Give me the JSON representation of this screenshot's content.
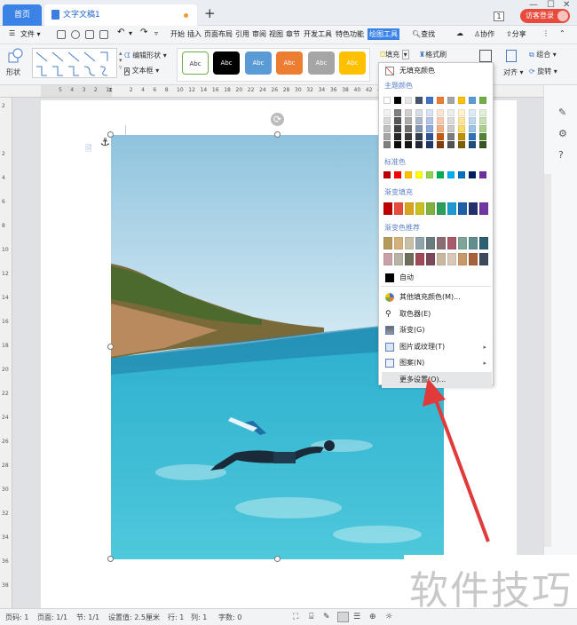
{
  "titlebar": {
    "home_tab": "首页",
    "doc_tab": "文字文稿1",
    "window_number": "1",
    "visitor_label": "访客登录"
  },
  "menubar": {
    "file": "文件",
    "items": [
      "开始",
      "插入",
      "页面布局",
      "引用",
      "审阅",
      "视图",
      "章节",
      "开发工具",
      "特色功能",
      "绘图工具"
    ],
    "search": "查找",
    "collab": "协作",
    "share": "分享"
  },
  "ribbon": {
    "shape_label": "形状",
    "edit_shape": "编辑形状",
    "textbox": "文本框",
    "style_sample": "Abc",
    "fill": "填充",
    "format_painter": "格式刷",
    "combine": "组合",
    "align": "对齐",
    "rotate": "旋转"
  },
  "ruler": {
    "top": [
      "5",
      "4",
      "3",
      "2",
      "1",
      "",
      "2",
      "4",
      "6",
      "8",
      "10",
      "12",
      "14",
      "16",
      "18",
      "20",
      "22",
      "24",
      "26",
      "28",
      "30",
      "32",
      "34",
      "36",
      "38",
      "40",
      "42",
      "44",
      "46"
    ],
    "left": [
      "2",
      "",
      "2",
      "4",
      "6",
      "8",
      "10",
      "12",
      "14",
      "16",
      "18",
      "20",
      "22",
      "24",
      "26",
      "28",
      "30",
      "32",
      "34",
      "36",
      "38"
    ]
  },
  "dropdown": {
    "no_fill": "无填充颜色",
    "theme_colors_label": "主题颜色",
    "theme_top": [
      "#ffffff",
      "#000000",
      "#e7e6e6",
      "#44546a",
      "#4472c4",
      "#ed7d31",
      "#a5a5a5",
      "#ffc000",
      "#5b9bd5",
      "#70ad47"
    ],
    "theme_shades": [
      [
        "#f2f2f2",
        "#7f7f7f",
        "#d0cece",
        "#d6dce4",
        "#d9e2f3",
        "#fbe5d5",
        "#ededed",
        "#fff2cc",
        "#deebf6",
        "#e2efd9"
      ],
      [
        "#d9d9d9",
        "#595959",
        "#aeabab",
        "#adb9ca",
        "#b4c6e7",
        "#f7caac",
        "#dbdbdb",
        "#fee599",
        "#bdd7ee",
        "#c5e0b3"
      ],
      [
        "#bfbfbf",
        "#3f3f3f",
        "#757070",
        "#8496b0",
        "#8eaadb",
        "#f4b083",
        "#c9c9c9",
        "#ffd965",
        "#9cc3e5",
        "#a8d08d"
      ],
      [
        "#a6a6a6",
        "#262626",
        "#3a3838",
        "#323f4f",
        "#2f5496",
        "#c55a11",
        "#7b7b7b",
        "#bf9000",
        "#2e75b5",
        "#538135"
      ],
      [
        "#7f7f7f",
        "#0c0c0c",
        "#171616",
        "#222a35",
        "#1f3864",
        "#833c0b",
        "#525252",
        "#7f6000",
        "#1e4e79",
        "#375623"
      ]
    ],
    "standard_label": "标准色",
    "standard": [
      "#c00000",
      "#ff0000",
      "#ffc000",
      "#ffff00",
      "#92d050",
      "#00b050",
      "#00b0f0",
      "#0070c0",
      "#002060",
      "#7030a0"
    ],
    "gradient_label": "渐变填充",
    "gradient": [
      "#c00000",
      "#e84c3d",
      "#d9a520",
      "#c8c020",
      "#7fb040",
      "#2c9e5a",
      "#1e9ad0",
      "#1f5fa8",
      "#23306c",
      "#7236a2"
    ],
    "recommend_label": "渐变色推荐",
    "recommend_row1": [
      "#b59a5e",
      "#d4b07a",
      "#c7c0a8",
      "#8fa3a8",
      "#6a7b80",
      "#8a6d72",
      "#a85a6a",
      "#7ea598",
      "#5e8f8c",
      "#2d5f72"
    ],
    "recommend_row2": [
      "#c8a0a8",
      "#b7b2a6",
      "#6e6e5a",
      "#a04a58",
      "#7a4a5a",
      "#c8b8a0",
      "#d8c8b8",
      "#c89a6a",
      "#a8623a",
      "#3d4a5a"
    ],
    "auto": "自动",
    "menu_items": [
      {
        "label": "其他填充颜色(M)...",
        "icon": "color-wheel-icon",
        "has_arrow": false
      },
      {
        "label": "取色器(E)",
        "icon": "eyedropper-icon",
        "has_arrow": false
      },
      {
        "label": "渐变(G)",
        "icon": "gradient-icon",
        "has_arrow": false
      },
      {
        "label": "图片或纹理(T)",
        "icon": "picture-icon",
        "has_arrow": true
      },
      {
        "label": "图案(N)",
        "icon": "pattern-icon",
        "has_arrow": true
      },
      {
        "label": "更多设置(O)...",
        "icon": "",
        "has_arrow": false
      }
    ]
  },
  "statusbar": {
    "page_num": "页码: 1",
    "pages": "页面: 1/1",
    "section": "节: 1/1",
    "setting": "设置值: 2.5厘米",
    "row": "行: 1",
    "col": "列: 1",
    "words": "字数: 0"
  },
  "watermark": "软件技巧",
  "colors": {
    "accent": "#3b82e6",
    "arrow": "#e03a3a",
    "visitor": "#e84b3c"
  }
}
